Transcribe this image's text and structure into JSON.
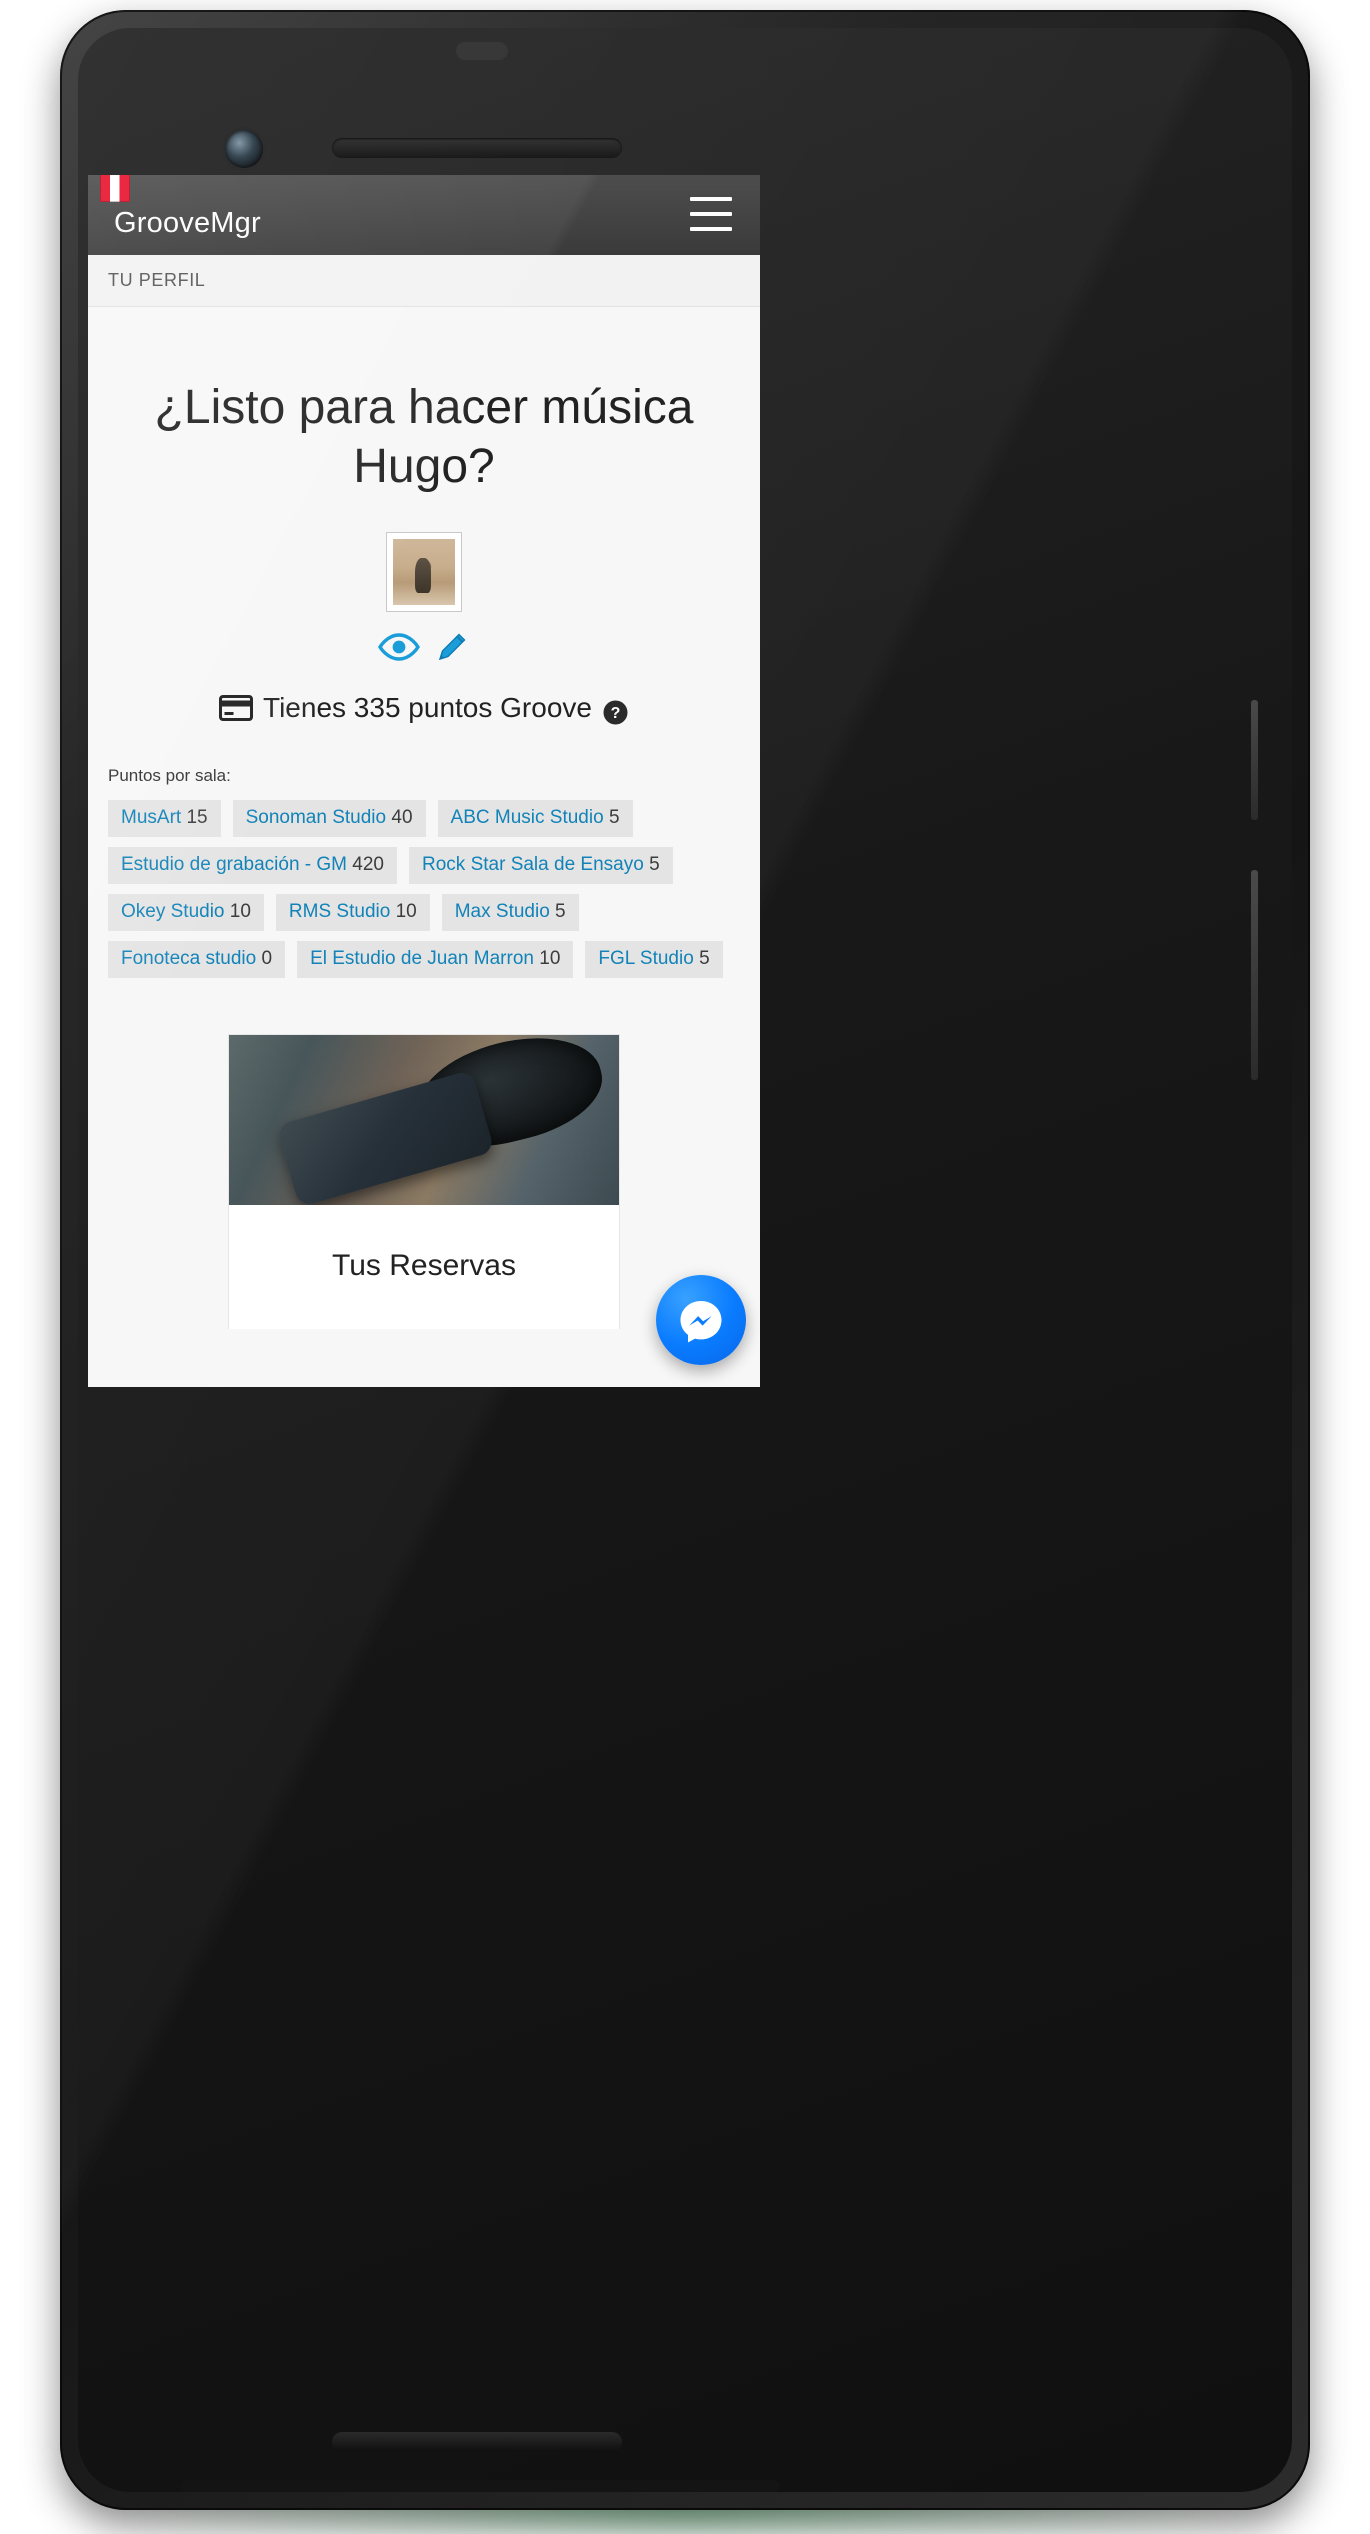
{
  "app": {
    "brand": "GrooveMgr",
    "flag_colors": [
      "#e8112d",
      "#ffffff"
    ],
    "menu_icon": "hamburger-menu-icon",
    "accent_color": "#1283b8",
    "appbar_color": "#434343"
  },
  "breadcrumb": {
    "label": "TU PERFIL"
  },
  "profile": {
    "headline": "¿Listo para hacer música Hugo?",
    "user_name": "Hugo",
    "avatar_alt": "profile-photo",
    "actions": [
      {
        "name": "view-profile",
        "icon": "eye-icon",
        "color": "#1a9dd9"
      },
      {
        "name": "edit-profile",
        "icon": "pencil-icon",
        "color": "#1a9dd9"
      }
    ]
  },
  "points": {
    "icon": "credit-card-icon",
    "text": "Tienes 335 puntos Groove",
    "total": 335,
    "currency_name": "puntos Groove",
    "help_icon": "question-mark-circle-icon"
  },
  "rooms": {
    "label": "Puntos por sala:",
    "items": [
      {
        "name": "MusArt",
        "points": "15"
      },
      {
        "name": "Sonoman Studio",
        "points": "40"
      },
      {
        "name": "ABC Music Studio",
        "points": "5"
      },
      {
        "name": "Estudio de grabación - GM",
        "points": "420"
      },
      {
        "name": "Rock Star Sala de Ensayo",
        "points": "5"
      },
      {
        "name": "Okey Studio",
        "points": "10"
      },
      {
        "name": "RMS Studio",
        "points": "10"
      },
      {
        "name": "Max Studio",
        "points": "5"
      },
      {
        "name": "Fonoteca studio",
        "points": "0"
      },
      {
        "name": "El Estudio de Juan Marron",
        "points": "10"
      },
      {
        "name": "FGL Studio",
        "points": "5"
      }
    ]
  },
  "cards": [
    {
      "title": "Tus Reservas",
      "image_alt": "headphones-phone-notebook-photo"
    }
  ],
  "chat": {
    "icon": "messenger-icon",
    "color": "#0a7cff"
  }
}
